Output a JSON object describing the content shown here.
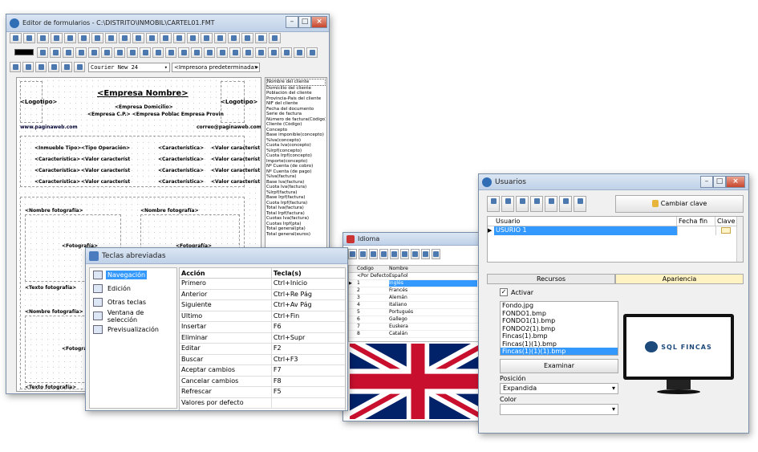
{
  "editor": {
    "title": "Editor de formularios - C:\\DISTRITO\\INMOBIL\\CARTEL01.FMT",
    "font_name": "Courier New 24",
    "printer": "<Impresora predeterminada>",
    "canvas": {
      "company": "<Empresa Nombre>",
      "logo_left": "<Logotipo>",
      "logo_right": "<Logotipo>",
      "domicilio": "<Empresa Domicilio>",
      "cp_line": "<Empresa C.P.>  <Empresa Poblac Empresa Provin",
      "web": "www.paginaweb.com",
      "mail": "correo@paginaweb.com",
      "rows": [
        [
          "<Inmueble Tipo>",
          "<Tipo Operación>",
          "<Característica>",
          "<Valor característ"
        ],
        [
          "<Característica>",
          "<Valor característ",
          "<Característica>",
          "<Valor característ"
        ],
        [
          "<Característica>",
          "<Valor característ",
          "<Característica>",
          "<Valor característ"
        ],
        [
          "<Característica>",
          "<Valor característ",
          "<Característica>",
          "<Valor característ"
        ]
      ],
      "photo_name": "<Nombre fotografía>",
      "photo": "<Fotografía>",
      "photo_text": "<Texto fotografía>"
    },
    "fields": [
      "Nombre del cliente",
      "Domicilio del cliente",
      "Población del cliente",
      "Provincia-País del cliente",
      "NIF del cliente",
      "Fecha del documento",
      "Serie de factura",
      "Número de factura(Código)",
      "Cliente (Código)",
      "Concepto",
      "Base imponible(concepto)",
      "%Iva(concepto)",
      "Cuota Iva(concepto)",
      "%Irpf(concepto)",
      "Cuota Irpf(concepto)",
      "Importe(concepto)",
      "Nº Cuenta (de cobro)",
      "Nº Cuenta (de pago)",
      "%Iva(factura)",
      "Base Iva(factura)",
      "Cuota Iva(factura)",
      "%Irpf(factura)",
      "Base Irpf(factura)",
      "Cuota Irpf(factura)",
      "Total Iva(factura)",
      "Total Irpf(factura)",
      "Cuotas Iva(factura)",
      "Cuotas Irpf(pta)",
      "Total general(pta)",
      "Total general(euros)"
    ]
  },
  "teclas": {
    "title": "Teclas abreviadas",
    "nav": [
      {
        "label": "Navegación",
        "icon": "navigation-icon"
      },
      {
        "label": "Edición",
        "icon": "edit-icon"
      },
      {
        "label": "Otras teclas",
        "icon": "keys-icon"
      },
      {
        "label": "Ventana de selección",
        "icon": "selection-window-icon"
      },
      {
        "label": "Previsualización",
        "icon": "preview-icon"
      }
    ],
    "headers": [
      "Acción",
      "Tecla(s)"
    ],
    "rows": [
      [
        "Primero",
        "Ctrl+Inicio"
      ],
      [
        "Anterior",
        "Ctrl+Re Pág"
      ],
      [
        "Siguiente",
        "Ctrl+Av Pág"
      ],
      [
        "Ultimo",
        "Ctrl+Fin"
      ],
      [
        "Insertar",
        "F6"
      ],
      [
        "Eliminar",
        "Ctrl+Supr"
      ],
      [
        "Editar",
        "F2"
      ],
      [
        "Buscar",
        "Ctrl+F3"
      ],
      [
        "Aceptar cambios",
        "F7"
      ],
      [
        "Cancelar cambios",
        "F8"
      ],
      [
        "Refrescar",
        "F5"
      ],
      [
        "Valores por defecto",
        ""
      ]
    ]
  },
  "idioma": {
    "title": "Idioma",
    "headers": [
      "Codigo",
      "Nombre"
    ],
    "rows": [
      [
        "<Por Defecto>",
        "Español"
      ],
      [
        "1",
        "Inglés"
      ],
      [
        "2",
        "Francés"
      ],
      [
        "3",
        "Alemán"
      ],
      [
        "4",
        "Italiano"
      ],
      [
        "5",
        "Portugués"
      ],
      [
        "6",
        "Gallego"
      ],
      [
        "7",
        "Euskera"
      ],
      [
        "8",
        "Catalán"
      ]
    ],
    "selected": 1
  },
  "usuarios": {
    "title": "Usuarios",
    "change_pw": "Cambiar clave",
    "headers": [
      "Usuario",
      "Fecha fin",
      "Clave"
    ],
    "row": "USURIO 1",
    "tabs": [
      "Recursos",
      "Apariencia"
    ],
    "activar": "Activar",
    "files": [
      "Fondo.jpg",
      "FONDO1.bmp",
      "FONDO1(1).bmp",
      "FONDO2(1).bmp",
      "Fincas(1).bmp",
      "Fincas(1)(1).bmp",
      "Fincas(1)(1)(1).bmp"
    ],
    "examinar": "Examinar",
    "posicion_label": "Posición",
    "posicion": "Expandida",
    "color_label": "Color",
    "color": "",
    "logo": "SQL FINCAS"
  }
}
